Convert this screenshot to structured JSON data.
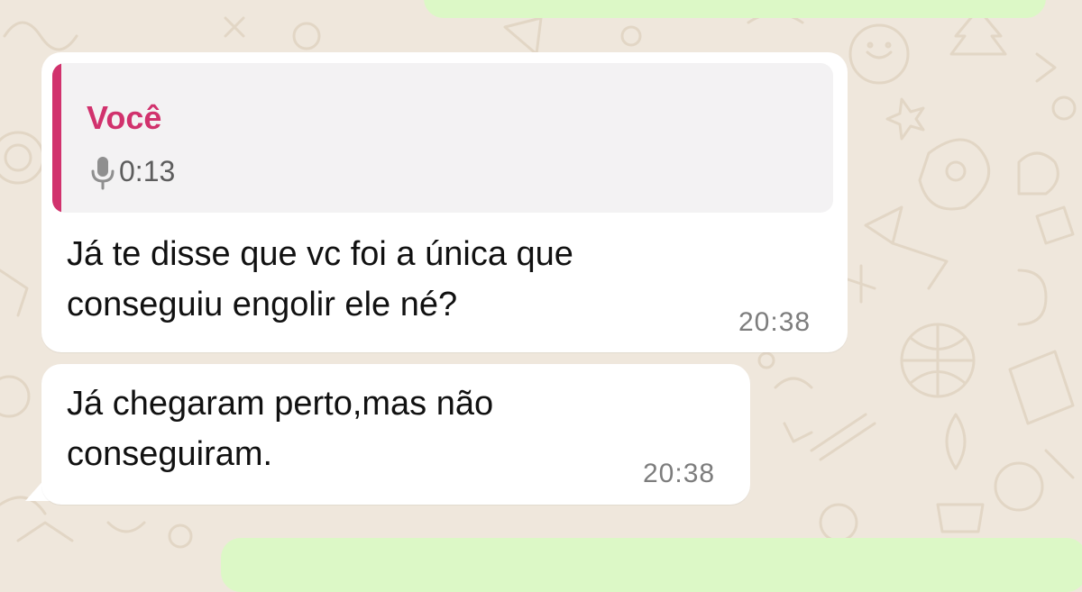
{
  "chat": {
    "messages": [
      {
        "direction": "incoming",
        "quote": {
          "author": "Você",
          "icon": "mic-icon",
          "duration": "0:13"
        },
        "lines": [
          "Já te disse que vc foi a única que",
          "conseguiu engolir ele né?"
        ],
        "time": "20:38"
      },
      {
        "direction": "incoming",
        "lines": [
          "Já chegaram perto,mas não",
          "conseguiram."
        ],
        "time": "20:38"
      }
    ]
  },
  "colors": {
    "wallpaper": "#efe7dc",
    "incoming_bubble": "#ffffff",
    "outgoing_bubble": "#dcf8c6",
    "quote_accent": "#d1326d",
    "quote_background": "#f3f2f3",
    "timestamp": "#7d7d7d"
  }
}
